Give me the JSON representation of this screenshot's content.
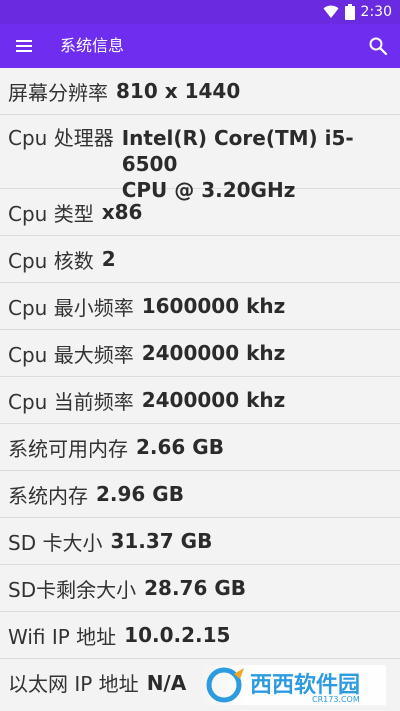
{
  "status_bar": {
    "time": "2:30"
  },
  "app_bar": {
    "title": "系统信息"
  },
  "rows": [
    {
      "label": "屏幕分辨率",
      "value": "810 x 1440"
    },
    {
      "label": "Cpu 处理器",
      "value_line1": "Intel(R) Core(TM) i5-6500",
      "value_line2": "CPU @ 3.20GHz"
    },
    {
      "label": "Cpu 类型",
      "value": "x86"
    },
    {
      "label": "Cpu 核数",
      "value": "2"
    },
    {
      "label": "Cpu 最小频率",
      "value": "1600000 khz"
    },
    {
      "label": "Cpu 最大频率",
      "value": "2400000 khz"
    },
    {
      "label": "Cpu 当前频率",
      "value": "2400000 khz"
    },
    {
      "label": "系统可用内存",
      "value": "2.66 GB"
    },
    {
      "label": "系统内存",
      "value": "2.96 GB"
    },
    {
      "label": "SD 卡大小",
      "value": "31.37 GB"
    },
    {
      "label": "SD卡剩余大小",
      "value": "28.76 GB"
    },
    {
      "label": "Wifi IP 地址",
      "value": "10.0.2.15"
    },
    {
      "label": "以太网 IP 地址",
      "value": "N/A"
    }
  ],
  "watermark": {
    "text": "西西软件园",
    "subtext": "CR173.COM"
  },
  "colors": {
    "primary": "#6f2df0",
    "status": "#6a2be0",
    "background": "#f3f3f3"
  },
  "icons": {
    "menu": "hamburger-menu-icon",
    "search": "search-icon",
    "wifi": "wifi-icon",
    "battery": "battery-icon"
  }
}
